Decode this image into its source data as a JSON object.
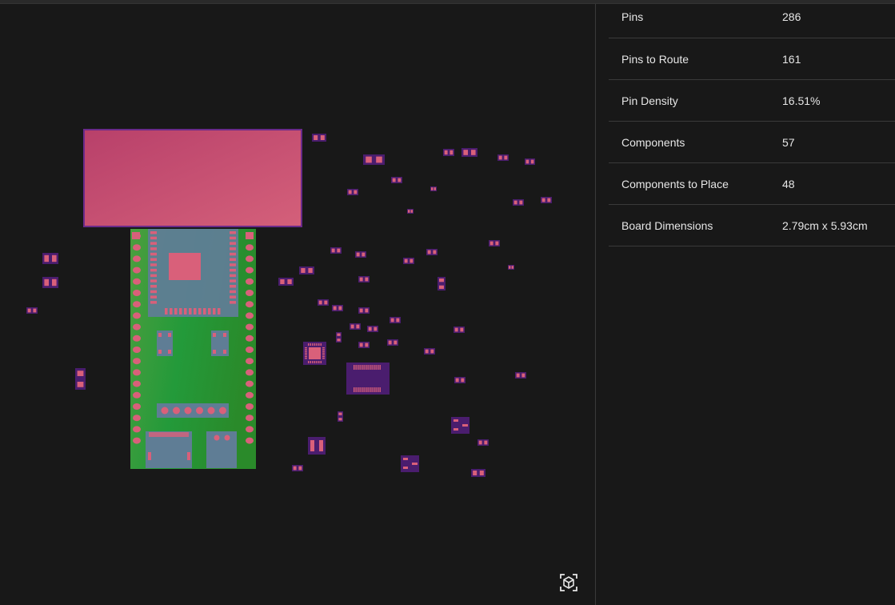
{
  "stats": [
    {
      "label": "Pins",
      "value": "286"
    },
    {
      "label": "Pins to Route",
      "value": "161"
    },
    {
      "label": "Pin Density",
      "value": "16.51%"
    },
    {
      "label": "Components",
      "value": "57"
    },
    {
      "label": "Components to Place",
      "value": "48"
    },
    {
      "label": "Board Dimensions",
      "value": "2.79cm x 5.93cm"
    }
  ],
  "colors": {
    "background": "#181818",
    "board_green": "#2e8b2e",
    "module": "#5a7b8a",
    "pad": "#d9607a",
    "component_body": "#4a1d6e",
    "component_large": "#c84c72"
  },
  "icons": {
    "view_3d": "cube-focus-icon"
  }
}
